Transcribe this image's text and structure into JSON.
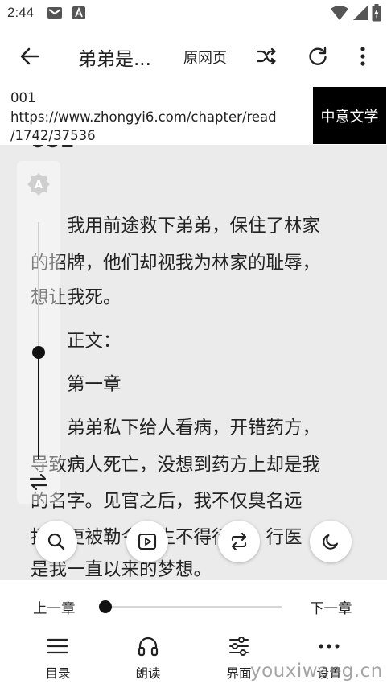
{
  "status_bar": {
    "time": "2:44"
  },
  "toolbar": {
    "title": "弟弟是...",
    "original_page_label": "原网页"
  },
  "chapter_info": {
    "title": "001",
    "url_line1": "https://www.zhongyi6.com/chapter/read",
    "url_line2": "/1742/37536",
    "source_name": "中意文学"
  },
  "reader": {
    "chapter_heading": "001",
    "lines": [
      "　　我用前途救下弟弟，保住了林家",
      "的招牌，他们却视我为林家的耻辱，",
      "想让我死。",
      "　　正文：",
      "　　第一章",
      "　　弟弟私下给人看病，开错药方，",
      "导致病人死亡，没想到药方上却是我",
      "的名字。见官之后，我不仅臭名远",
      "扬，更被勒令终生不得行医。行医",
      "是我一直以来的梦想。"
    ],
    "brightness_level": 0.45,
    "brightness_auto_label": "A"
  },
  "chapter_nav": {
    "prev_label": "上一章",
    "next_label": "下一章",
    "progress": 0.0
  },
  "bottom_menu": [
    {
      "label": "目录",
      "icon": "menu-list-icon"
    },
    {
      "label": "朗读",
      "icon": "headphones-icon"
    },
    {
      "label": "界面",
      "icon": "sliders-icon"
    },
    {
      "label": "设置",
      "icon": "more-icon"
    }
  ],
  "watermark": "youxiwang.cn",
  "colors": {
    "reader_bg": "#ebebeb",
    "source_badge_bg": "#000000",
    "text": "#222222"
  }
}
